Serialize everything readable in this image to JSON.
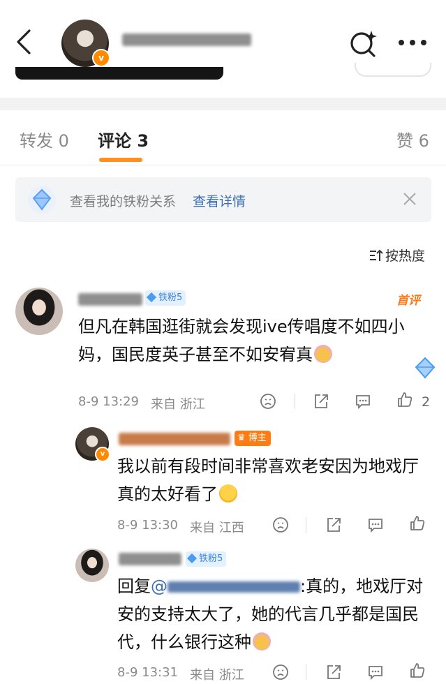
{
  "header": {
    "back_icon": "chevron-left-icon",
    "search_icon": "search-sparkle-icon",
    "more_icon": "ellipsis-icon"
  },
  "tabs": [
    {
      "label": "转发 0"
    },
    {
      "label": "评论 3"
    },
    {
      "label": "赞 6"
    }
  ],
  "banner": {
    "text": "查看我的铁粉关系",
    "link": "查看详情"
  },
  "sort": {
    "label": "按热度"
  },
  "comments": [
    {
      "badge": "铁粉5",
      "first_label": "首评",
      "text": "但凡在韩国逛街就会发现ive传唱度不如四小妈，国民度英子甚至不如安宥真",
      "time": "8-9 13:29",
      "location": "来自 浙江",
      "likes": "2"
    },
    {
      "badge": "博主",
      "text": "我以前有段时间非常喜欢老安因为地戏厅真的太好看了",
      "time": "8-9 13:30",
      "location": "来自 江西"
    },
    {
      "badge": "铁粉5",
      "reply_prefix": "回复",
      "mention": "@",
      "text": ":真的，地戏厅对安的支持太大了，她的代言几乎都是国民代，什么银行这种",
      "time": "8-9 13:31",
      "location": "来自 浙江"
    }
  ],
  "colors": {
    "accent": "#ff8f1f",
    "link": "#3d6fb5",
    "fan_badge_bg": "#e3f0ff",
    "blogger_badge": "#ff7b14"
  }
}
